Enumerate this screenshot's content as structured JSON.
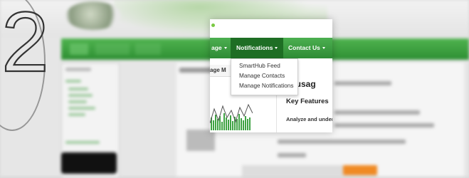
{
  "nav": {
    "partial_item_label": "age",
    "notifications_label": "Notifications",
    "contact_label": "Contact Us"
  },
  "notifications_menu": {
    "items": [
      "SmartHub Feed",
      "Manage Contacts",
      "Manage Notifications"
    ]
  },
  "main": {
    "panel_title": "age M",
    "heading": "our usag",
    "subheading": "Key Features",
    "body_text": "Analyze and under"
  },
  "overlay": {
    "step_number": "2"
  },
  "colors": {
    "nav_green": "#3a9d3f",
    "nav_active": "#1e6e24",
    "accent_orange": "#f08a24"
  }
}
